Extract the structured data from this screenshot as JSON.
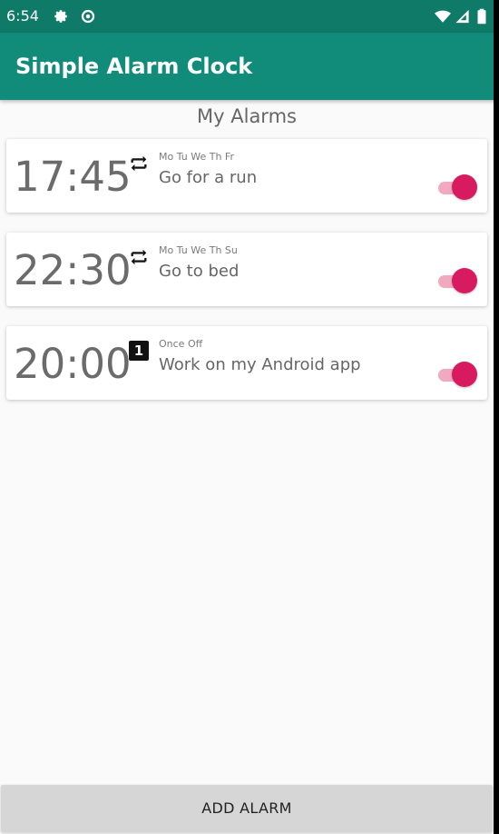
{
  "status_bar": {
    "time": "6:54",
    "icons": [
      "gear-icon",
      "data-saver-icon",
      "wifi-icon",
      "cell-signal-icon",
      "battery-icon"
    ]
  },
  "app_bar": {
    "title": "Simple Alarm Clock"
  },
  "section_title": "My Alarms",
  "alarms": [
    {
      "time": "17:45",
      "days": "Mo Tu We Th Fr",
      "label": "Go for a run",
      "mode_icon": "repeat-icon",
      "enabled": true
    },
    {
      "time": "22:30",
      "days": "Mo Tu We Th Su",
      "label": "Go to bed",
      "mode_icon": "repeat-icon",
      "enabled": true
    },
    {
      "time": "20:00",
      "days": "Once Off",
      "label": "Work on my Android app",
      "mode_icon": "one-time-icon",
      "mode_badge": "1",
      "enabled": true
    }
  ],
  "add_button": {
    "label": "ADD ALARM"
  },
  "colors": {
    "status_bar": "#0f7a67",
    "app_bar": "#128c7a",
    "accent": "#d81b60",
    "toggle_track": "#f0a9bf"
  }
}
